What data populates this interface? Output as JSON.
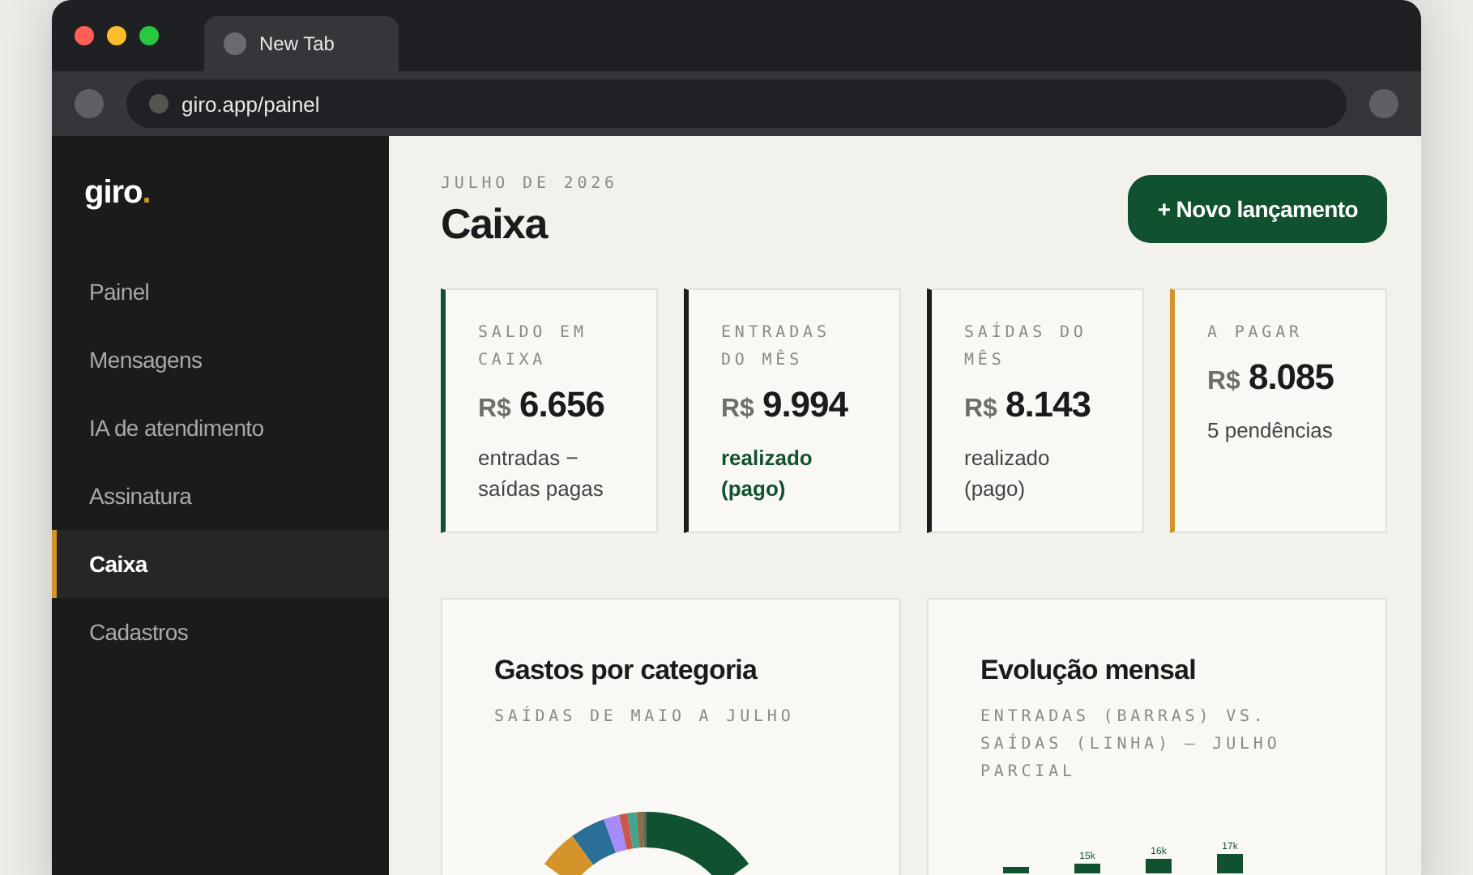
{
  "browser": {
    "tab": {
      "title": "New Tab",
      "selected": true
    },
    "url": "giro.app/painel"
  },
  "sidebar": {
    "logo": "giro",
    "logo_dot": ".",
    "items": [
      {
        "label": "Painel",
        "selected": false
      },
      {
        "label": "Mensagens",
        "selected": false
      },
      {
        "label": "IA de atendimento",
        "selected": false
      },
      {
        "label": "Assinatura",
        "selected": false
      },
      {
        "label": "Caixa",
        "selected": true
      },
      {
        "label": "Cadastros",
        "selected": false
      }
    ]
  },
  "header": {
    "period": "JULHO DE 2026",
    "title": "Caixa",
    "action": "+ Novo lançamento"
  },
  "stats": [
    {
      "label": "SALDO EM CAIXA",
      "currency": "R$",
      "amount": "6.656",
      "note": "entradas − saídas pagas",
      "highlight": false,
      "color": "#10512f"
    },
    {
      "label": "ENTRADAS DO MÊS",
      "currency": "R$",
      "amount": "9.994",
      "note": "realizado (pago)",
      "highlight": true,
      "color": "#1b1b1b"
    },
    {
      "label": "SAÍDAS DO MÊS",
      "currency": "R$",
      "amount": "8.143",
      "note": "realizado (pago)",
      "highlight": false,
      "color": "#1b1b1b"
    },
    {
      "label": "A PAGAR",
      "currency": "R$",
      "amount": "8.085",
      "note": "5 pendências",
      "highlight": false,
      "color": "#d4942a"
    }
  ],
  "panels": [
    {
      "kind": "donut",
      "title": "Gastos por categoria",
      "subtitle": "SAÍDAS DE MAIO A JULHO"
    },
    {
      "kind": "bars",
      "title": "Evolução mensal",
      "subtitle": "ENTRADAS (BARRAS) VS. SAÍDAS (LINHA) — JULHO PARCIAL",
      "bar_labels": [
        "15k",
        "16k",
        "17k"
      ]
    }
  ]
}
